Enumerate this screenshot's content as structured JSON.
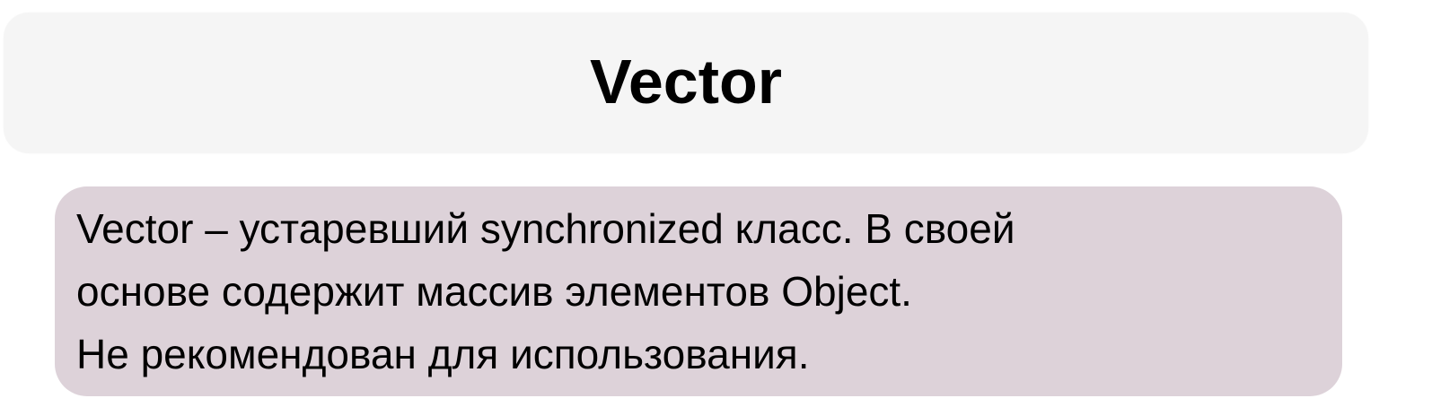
{
  "title": "Vector",
  "body": {
    "lines": [
      "Vector – устаревший synchronized класс. В своей",
      "основе содержит массив элементов Object.",
      "Не рекомендован для использования."
    ]
  },
  "colors": {
    "title_box_bg": "#f5f5f5",
    "body_box_bg": "#ddd2d9",
    "text": "#000000"
  }
}
